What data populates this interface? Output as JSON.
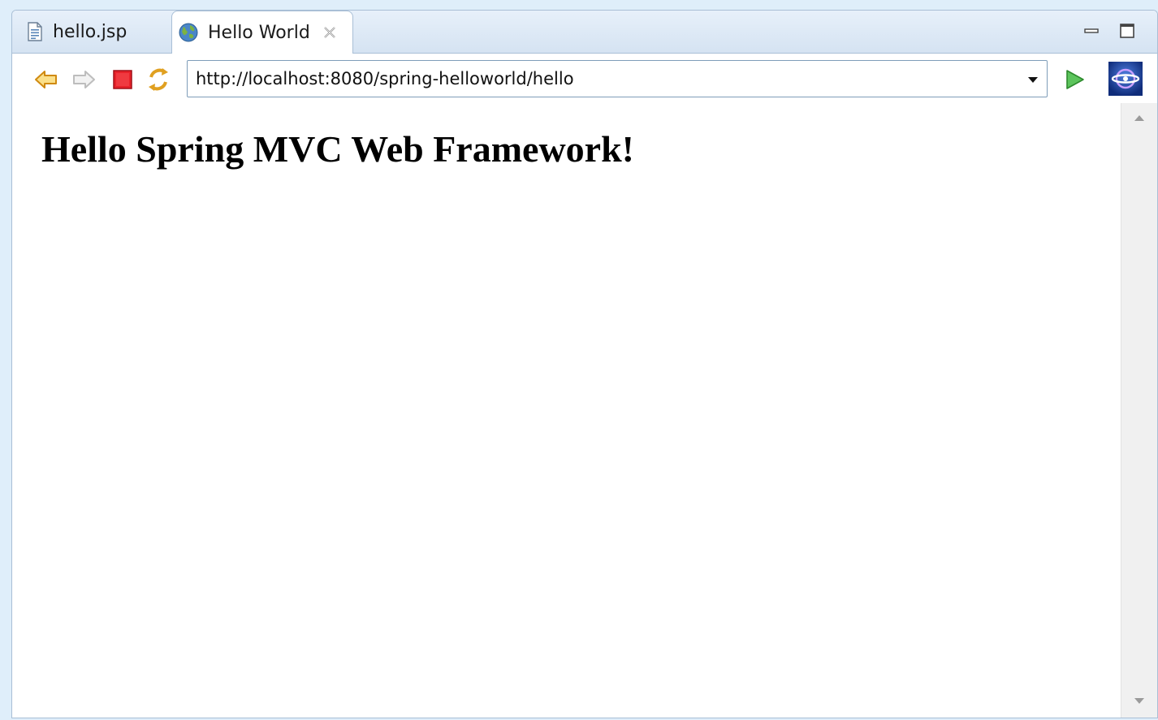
{
  "tabs": [
    {
      "label": "hello.jsp",
      "icon": "jsp-file-icon",
      "active": false
    },
    {
      "label": "Hello World",
      "icon": "globe-icon",
      "active": true
    }
  ],
  "window_controls": {
    "minimize_icon": "minimize-icon",
    "maximize_icon": "maximize-icon"
  },
  "toolbar": {
    "back_icon": "back-arrow-icon",
    "forward_icon": "forward-arrow-icon",
    "stop_icon": "stop-icon",
    "refresh_icon": "refresh-icon",
    "go_icon": "go-icon",
    "browser_logo_icon": "eclipse-browser-icon"
  },
  "address": {
    "url": "http://localhost:8080/spring-helloworld/hello"
  },
  "page": {
    "heading": "Hello Spring MVC Web Framework!"
  },
  "colors": {
    "accent": "#a9bfd6",
    "stop_red": "#e8222a",
    "go_green": "#3aa53a",
    "arrow_orange": "#e8a020"
  }
}
